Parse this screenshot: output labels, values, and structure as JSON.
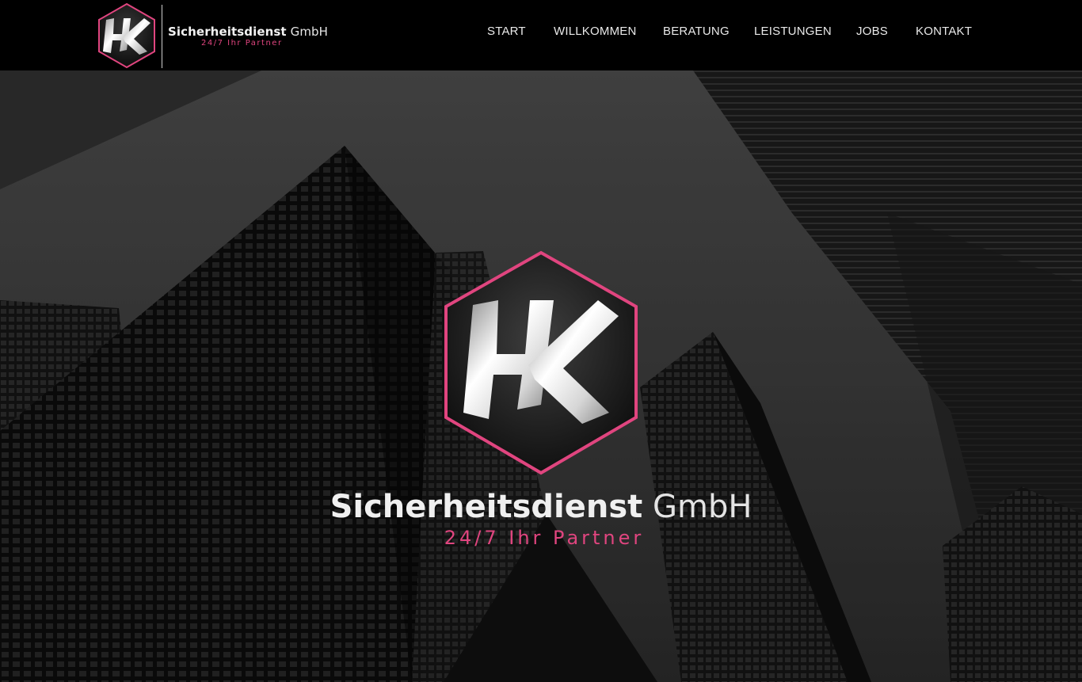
{
  "brand": {
    "name_bold": "Sicherheitsdienst",
    "name_light": "GmbH",
    "tagline": "24/7 Ihr Partner",
    "accent_color": "#e0457f",
    "logo_mark": "HK"
  },
  "nav": {
    "items": [
      {
        "label": "START"
      },
      {
        "label": "WILLKOMMEN"
      },
      {
        "label": "BERATUNG"
      },
      {
        "label": "LEISTUNGEN"
      },
      {
        "label": "JOBS"
      },
      {
        "label": "KONTAKT"
      }
    ]
  },
  "hero": {
    "title_bold": "Sicherheitsdienst",
    "title_light": "GmbH",
    "tagline": "24/7 Ihr Partner",
    "background": "skyscrapers-photo"
  }
}
